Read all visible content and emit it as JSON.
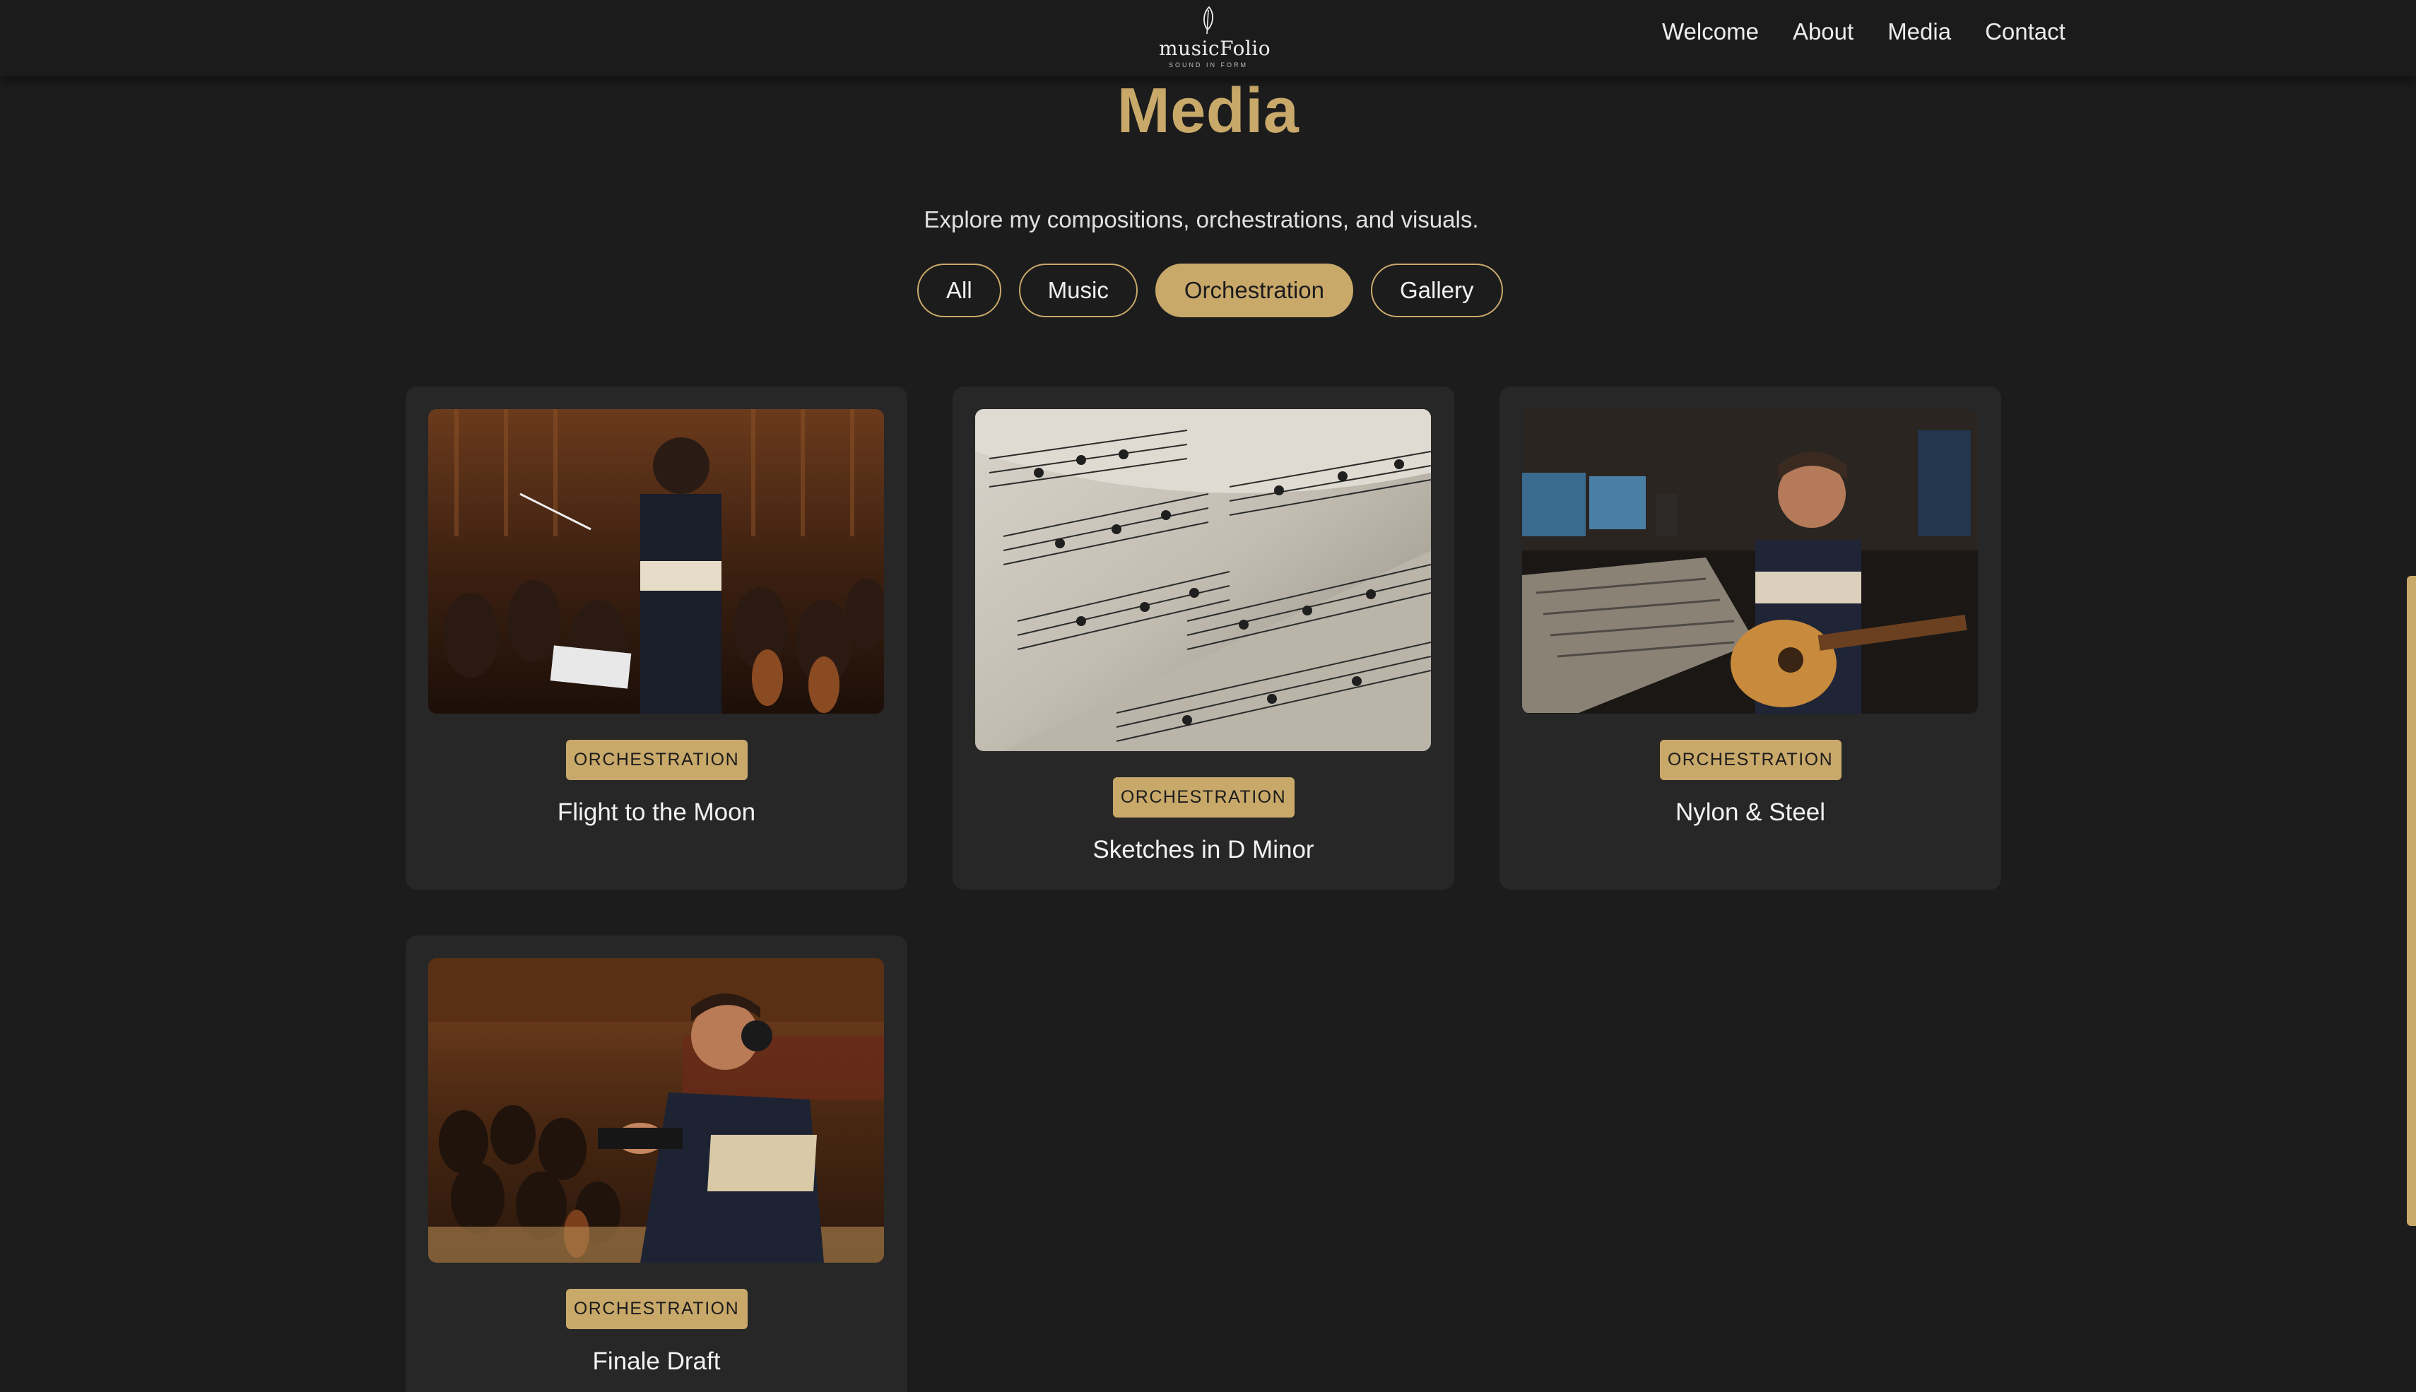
{
  "brand": {
    "name": "musicFolio",
    "tagline": "SOUND IN FORM"
  },
  "nav": {
    "links": [
      "Welcome",
      "About",
      "Media",
      "Contact"
    ]
  },
  "page": {
    "title": "Media",
    "intro": "Explore my compositions, orchestrations, and visuals."
  },
  "filters": {
    "options": [
      "All",
      "Music",
      "Orchestration",
      "Gallery"
    ],
    "active": "Orchestration"
  },
  "items": [
    {
      "category": "ORCHESTRATION",
      "title": "Flight to the Moon"
    },
    {
      "category": "ORCHESTRATION",
      "title": "Sketches in D Minor"
    },
    {
      "category": "ORCHESTRATION",
      "title": "Nylon & Steel"
    },
    {
      "category": "ORCHESTRATION",
      "title": "Finale Draft"
    }
  ],
  "colors": {
    "accent": "#c9a96a",
    "background": "#1c1c1c",
    "card": "#272727",
    "text": "#ececec"
  }
}
